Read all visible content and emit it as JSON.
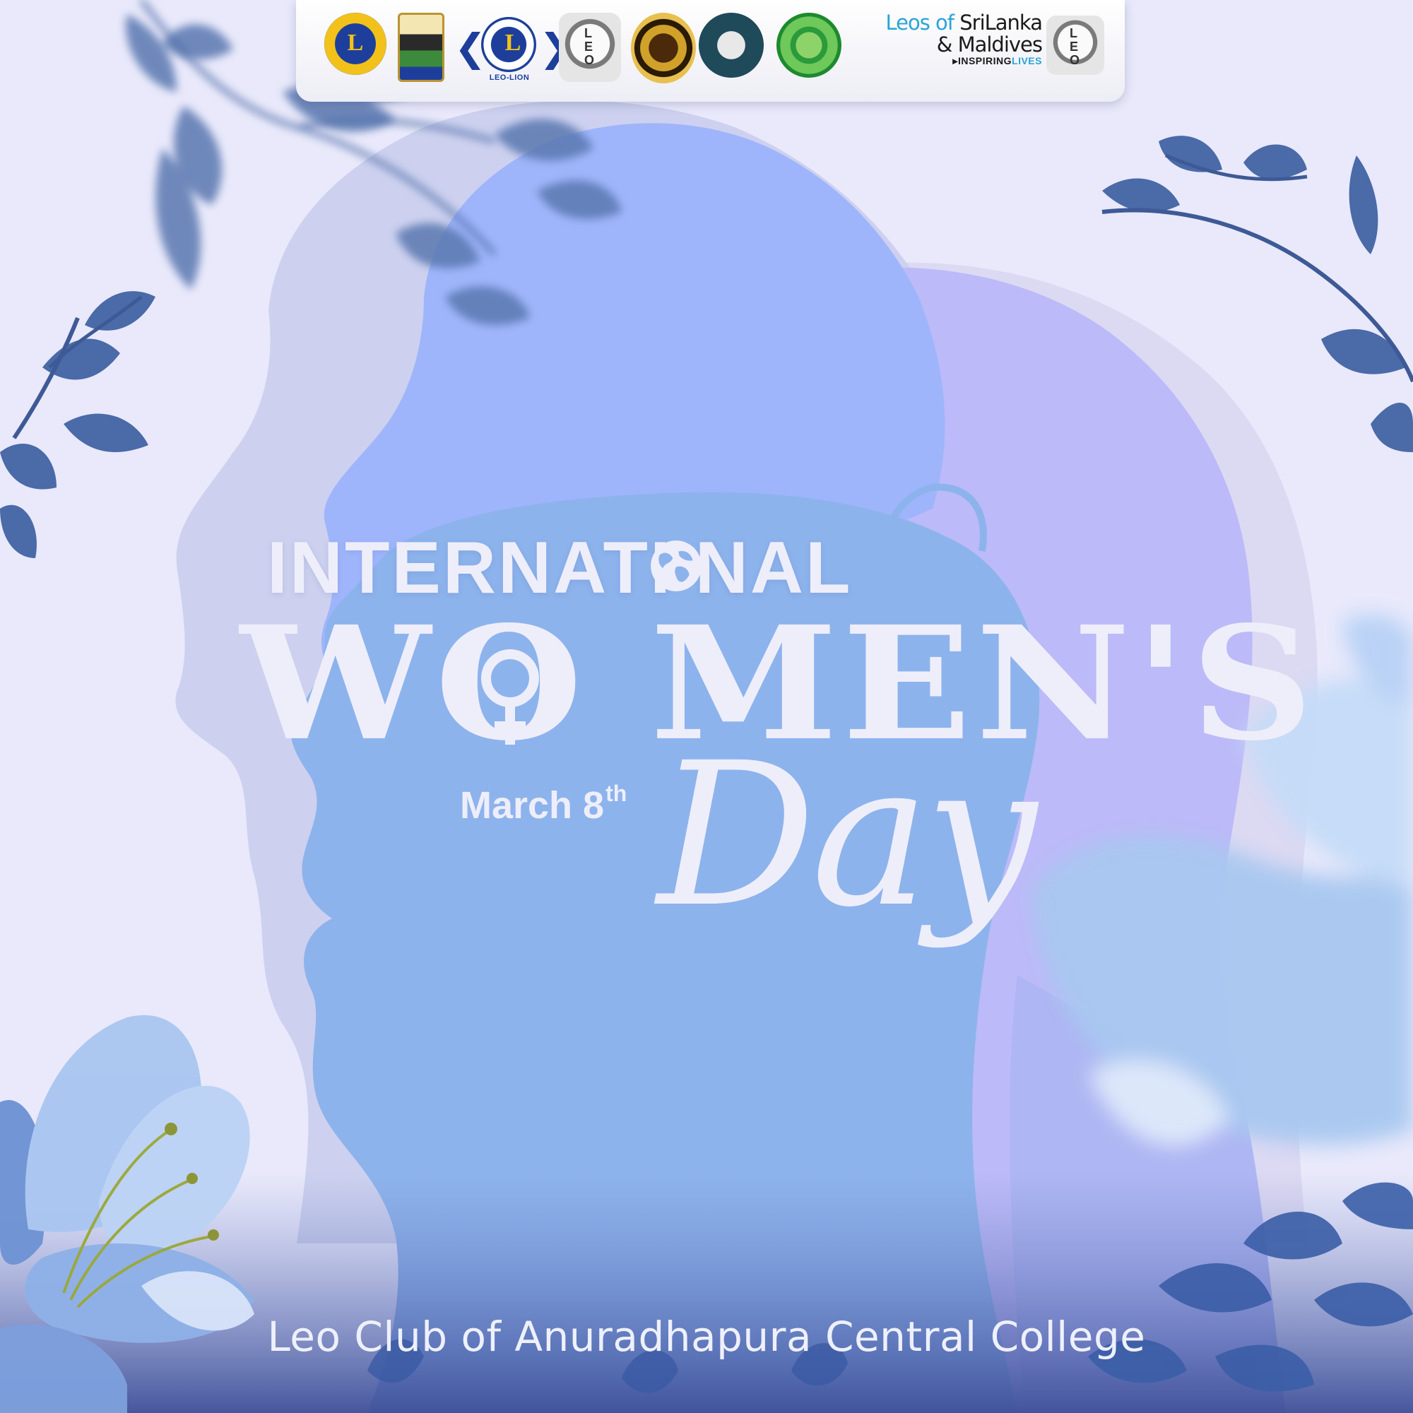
{
  "logo_bar": {
    "logos": [
      "lions-clubs-logo",
      "district-logo",
      "leo-lion-logo",
      "leo-logo",
      "gold-crest-logo",
      "leo-district-306-logo",
      "green-college-logo",
      "leo-logo"
    ],
    "leo_lion_caption": "LEO-LION",
    "brand": {
      "line1_a": "Leos of ",
      "line1_b": "SriLanka",
      "line2": "& Maldives",
      "line3_a": "INSPIRING",
      "line3_b": "LIVES"
    }
  },
  "title": {
    "international": "INTERNATI   NAL",
    "womens": "WO MEN'S",
    "date_main": "March 8",
    "date_sup": "th",
    "day": "Day"
  },
  "footer": {
    "club_name": "Leo Club of Anuradhapura Central College"
  },
  "colors": {
    "background": "#e9e9fb",
    "front_silhouette": "#8db3ec",
    "back_silhouette": "#bcbaf8",
    "text_light": "#eeeefb",
    "leaf": "#3f5f9a",
    "brand_blue": "#2aa3d8"
  }
}
